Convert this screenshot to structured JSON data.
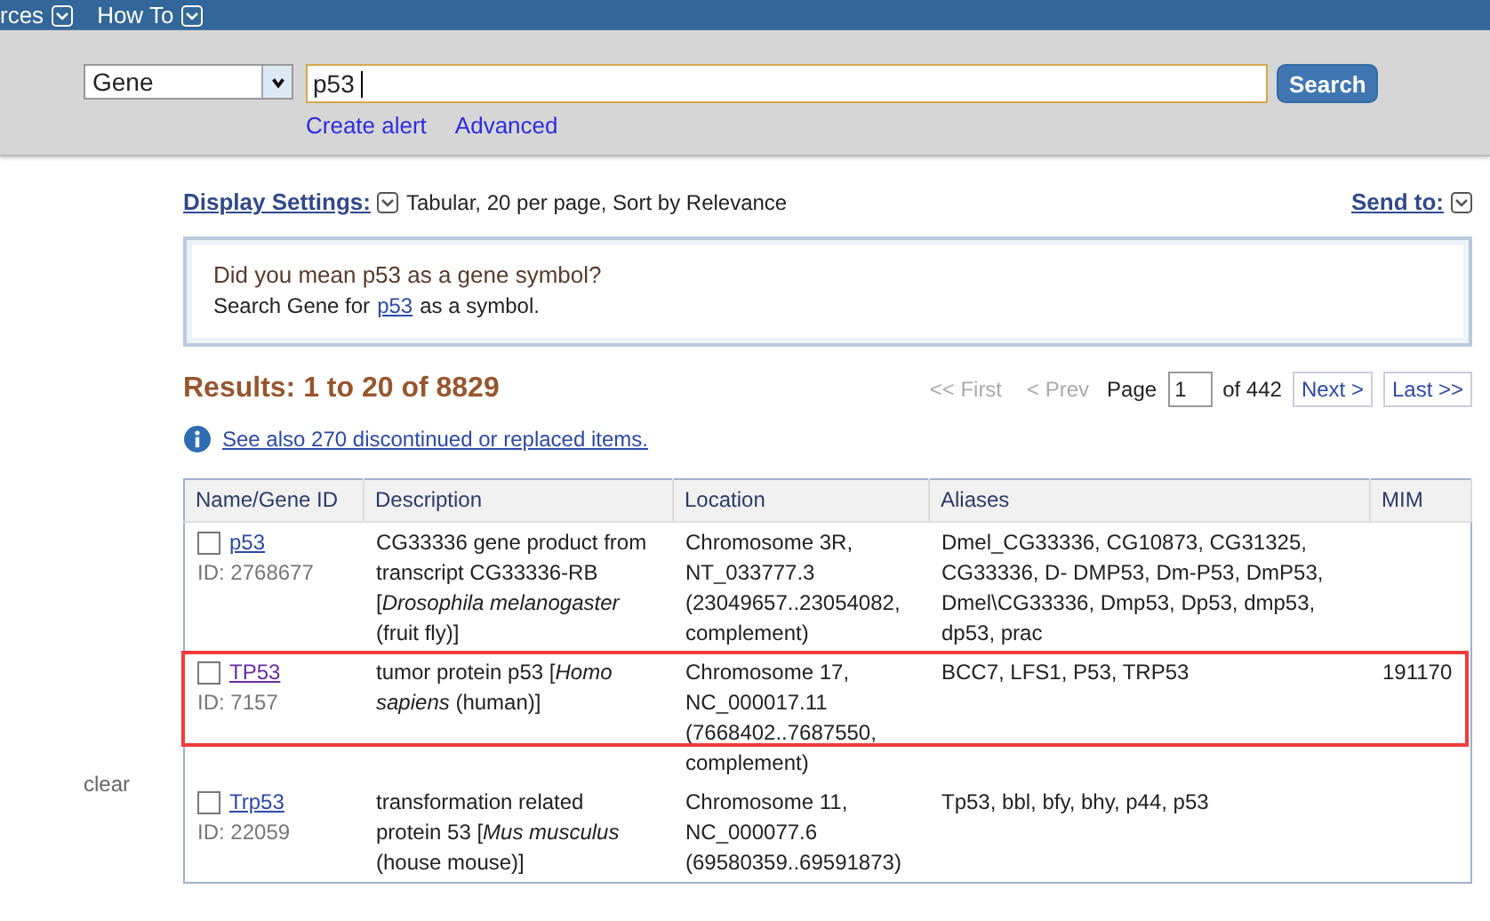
{
  "nav": [
    {
      "label": "rces"
    },
    {
      "label": "How To"
    }
  ],
  "search": {
    "database": "Gene",
    "value": "p53",
    "button": "Search",
    "links": [
      "Create alert",
      "Advanced"
    ]
  },
  "display_settings": {
    "label": "Display Settings:",
    "summary": "Tabular, 20 per page, Sort by Relevance",
    "send_to": "Send to:"
  },
  "suggestion": {
    "question": "Did you mean p53 as a gene symbol?",
    "before": "Search Gene for",
    "link": "p53",
    "after": "as a symbol."
  },
  "results": {
    "title": "Results: 1 to 20 of 8829",
    "note": "See also 270 discontinued or replaced items."
  },
  "pager": {
    "buttons": [
      {
        "label": "<< First",
        "disabled": true
      },
      {
        "label": "< Prev",
        "disabled": true
      }
    ],
    "page_label": "Page",
    "page": "1",
    "of": "of 442",
    "next": [
      {
        "label": "Next >",
        "disabled": false
      },
      {
        "label": "Last >>",
        "disabled": false
      }
    ]
  },
  "sidebar": {
    "clear": "clear"
  },
  "table": {
    "columns": [
      "Name/Gene ID",
      "Description",
      "Location",
      "Aliases",
      "MIM"
    ],
    "rows": [
      {
        "checked": false,
        "name": "p53",
        "visited": false,
        "id": "ID: 2768677",
        "description": "CG33336 gene product from transcript CG33336-RB [*Drosophila melanogaster* (fruit fly)]",
        "location": "Chromosome 3R, NT_033777.3 (23049657..23054082, complement)",
        "aliases": "Dmel_CG33336, CG10873, CG31325, CG33336, D- DMP53, Dm-P53, DmP53, Dmel\\CG33336, Dmp53, Dp53, dmp53, dp53, prac",
        "mim": "",
        "highlighted": false
      },
      {
        "checked": false,
        "name": "TP53",
        "visited": true,
        "id": "ID: 7157",
        "description": "tumor protein p53 [*Homo sapiens* (human)]",
        "location": "Chromosome 17, NC_000017.11 (7668402..7687550, complement)",
        "aliases": "BCC7, LFS1, P53, TRP53",
        "mim": "191170",
        "highlighted": true
      },
      {
        "checked": false,
        "name": "Trp53",
        "visited": false,
        "id": "ID: 22059",
        "description": "transformation related protein 53 [*Mus musculus* (house mouse)]",
        "location": "Chromosome 11, NC_000077.6 (69580359..69591873)",
        "aliases": "Tp53, bbl, bfy, bhy, p44, p53",
        "mim": "",
        "highlighted": false
      }
    ]
  }
}
